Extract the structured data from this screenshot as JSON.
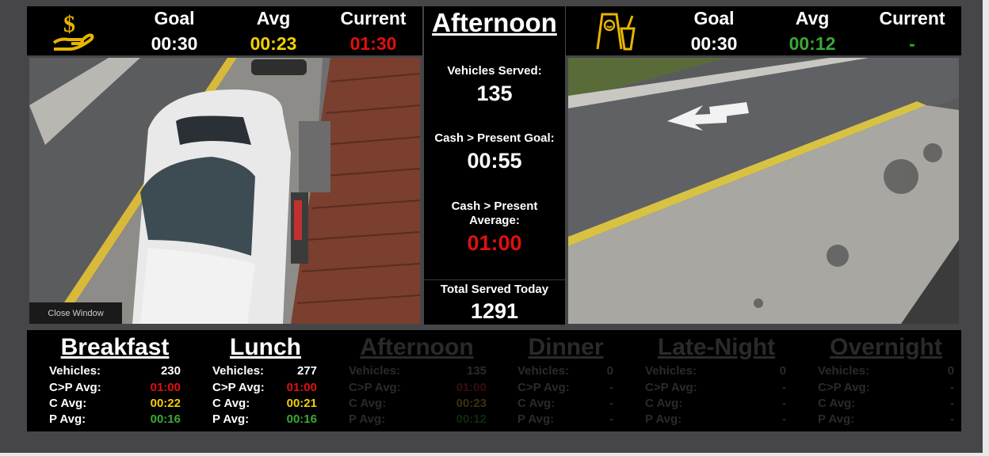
{
  "left_stats": {
    "icon": "cash-dollar-icon",
    "goal_label": "Goal",
    "avg_label": "Avg",
    "current_label": "Current",
    "goal": "00:30",
    "avg": "00:23",
    "current": "01:30"
  },
  "right_stats": {
    "icon": "present-food-icon",
    "goal_label": "Goal",
    "avg_label": "Avg",
    "current_label": "Current",
    "goal": "00:30",
    "avg": "00:12",
    "current": "-"
  },
  "center": {
    "title": "Afternoon",
    "vehicles_served_label": "Vehicles Served:",
    "vehicles_served": "135",
    "cp_goal_label": "Cash > Present Goal:",
    "cp_goal": "00:55",
    "cp_avg_label_1": "Cash > Present",
    "cp_avg_label_2": "Average:",
    "cp_avg": "01:00",
    "total_label": "Total Served Today",
    "total": "1291"
  },
  "camera": {
    "close_label": "Close Window"
  },
  "row_labels": {
    "vehicles": "Vehicles:",
    "cp": "C>P Avg:",
    "c": "C Avg:",
    "p": "P Avg:"
  },
  "dayparts": [
    {
      "name": "Breakfast",
      "vehicles": "230",
      "cp": "01:00",
      "c": "00:22",
      "p": "00:16"
    },
    {
      "name": "Lunch",
      "vehicles": "277",
      "cp": "01:00",
      "c": "00:21",
      "p": "00:16"
    },
    {
      "name": "Afternoon",
      "vehicles": "135",
      "cp": "01:00",
      "c": "00:23",
      "p": "00:12"
    },
    {
      "name": "Dinner",
      "vehicles": "0",
      "cp": "-",
      "c": "-",
      "p": "-"
    },
    {
      "name": "Late-Night",
      "vehicles": "0",
      "cp": "-",
      "c": "-",
      "p": "-"
    },
    {
      "name": "Overnight",
      "vehicles": "0",
      "cp": "-",
      "c": "-",
      "p": "-"
    }
  ],
  "colors": {
    "red": "#e01010",
    "yellow": "#f2d000",
    "green": "#3aa935",
    "icon_gold": "#e8b400"
  }
}
